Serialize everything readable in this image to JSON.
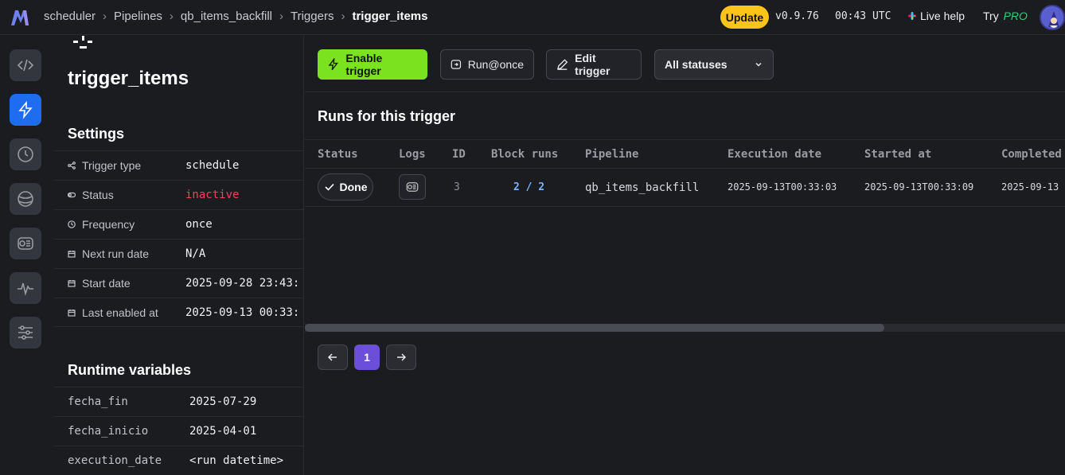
{
  "header": {
    "breadcrumbs": [
      "scheduler",
      "Pipelines",
      "qb_items_backfill",
      "Triggers"
    ],
    "current": "trigger_items",
    "update_label": "Update",
    "version": "v0.9.76",
    "clock": "00:43 UTC",
    "live_help": "Live help",
    "try_label": "Try",
    "pro_label": "PRO"
  },
  "nav": {
    "items": [
      "code-icon",
      "lightning-icon",
      "clock-icon",
      "globe-icon",
      "logs-icon",
      "activity-icon",
      "settings-sliders-icon"
    ],
    "active": "lightning-icon"
  },
  "panel": {
    "title": "trigger_items",
    "settings_title": "Settings",
    "settings": [
      {
        "label": "Trigger type",
        "value": "schedule",
        "icon": "share-icon"
      },
      {
        "label": "Status",
        "value": "inactive",
        "icon": "toggle-icon"
      },
      {
        "label": "Frequency",
        "value": "once",
        "icon": "clock-icon"
      },
      {
        "label": "Next run date",
        "value": "N/A",
        "icon": "calendar-icon"
      },
      {
        "label": "Start date",
        "value": "2025-09-28 23:43:",
        "icon": "calendar-icon"
      },
      {
        "label": "Last enabled at",
        "value": "2025-09-13 00:33:",
        "icon": "calendar-icon"
      }
    ],
    "runtime_title": "Runtime variables",
    "variables": [
      {
        "name": "fecha_fin",
        "value": "2025-07-29"
      },
      {
        "name": "fecha_inicio",
        "value": "2025-04-01"
      },
      {
        "name": "execution_date",
        "value": "<run datetime>"
      }
    ]
  },
  "toolbar": {
    "enable_label": "Enable trigger",
    "run_label": "Run@once",
    "edit_label": "Edit trigger",
    "status_filter": "All statuses"
  },
  "runs": {
    "title": "Runs for this trigger",
    "columns": [
      "Status",
      "Logs",
      "ID",
      "Block runs",
      "Pipeline",
      "Execution date",
      "Started at",
      "Completed"
    ],
    "rows": [
      {
        "status": "Done",
        "id": "3",
        "block_runs": "2 / 2",
        "pipeline": "qb_items_backfill",
        "execution_date": "2025-09-13T00:33:03",
        "started_at": "2025-09-13T00:33:09",
        "completed": "2025-09-13"
      }
    ]
  },
  "pagination": {
    "page": "1"
  },
  "colors": {
    "accent_green": "#7ae21e",
    "active_nav": "#1e6cf0",
    "inactive": "#f0445a",
    "update": "#fcc419",
    "page": "#6b4fd8"
  }
}
